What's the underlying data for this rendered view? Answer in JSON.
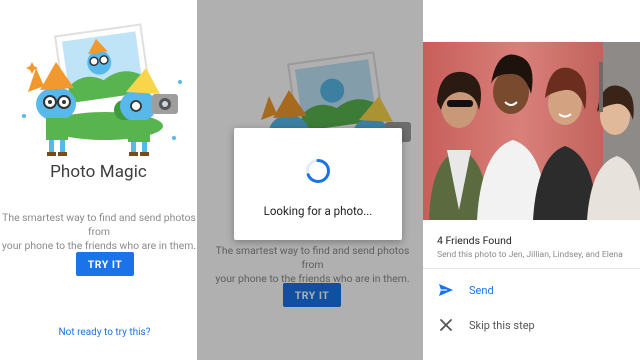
{
  "screens": [
    {
      "title": "Photo Magic",
      "description_line1": "The smartest way to find and send photos from",
      "description_line2": "your phone to the friends who are in them.",
      "cta_label": "TRY IT",
      "secondary_link": "Not ready to try this?"
    },
    {
      "description_line1": "The smartest way to find and send photos from",
      "description_line2": "your phone to the friends who are in them.",
      "cta_label": "TRY IT",
      "dialog": {
        "message": "Looking for a photo...",
        "icon": "loading-spinner-icon"
      }
    },
    {
      "found_title": "4 Friends Found",
      "send_to": "Send this photo to Jen, Jillian, Lindsey, and Elena",
      "actions": [
        {
          "label": "Send",
          "icon": "send-icon",
          "color": "#1a73e8"
        },
        {
          "label": "Skip this step",
          "icon": "close-icon",
          "color": "#555555"
        }
      ]
    }
  ],
  "colors": {
    "accent": "#1a73e8",
    "character_body": "#58b8ea",
    "character_hat": "#f1992f",
    "grass": "#58b44f"
  }
}
